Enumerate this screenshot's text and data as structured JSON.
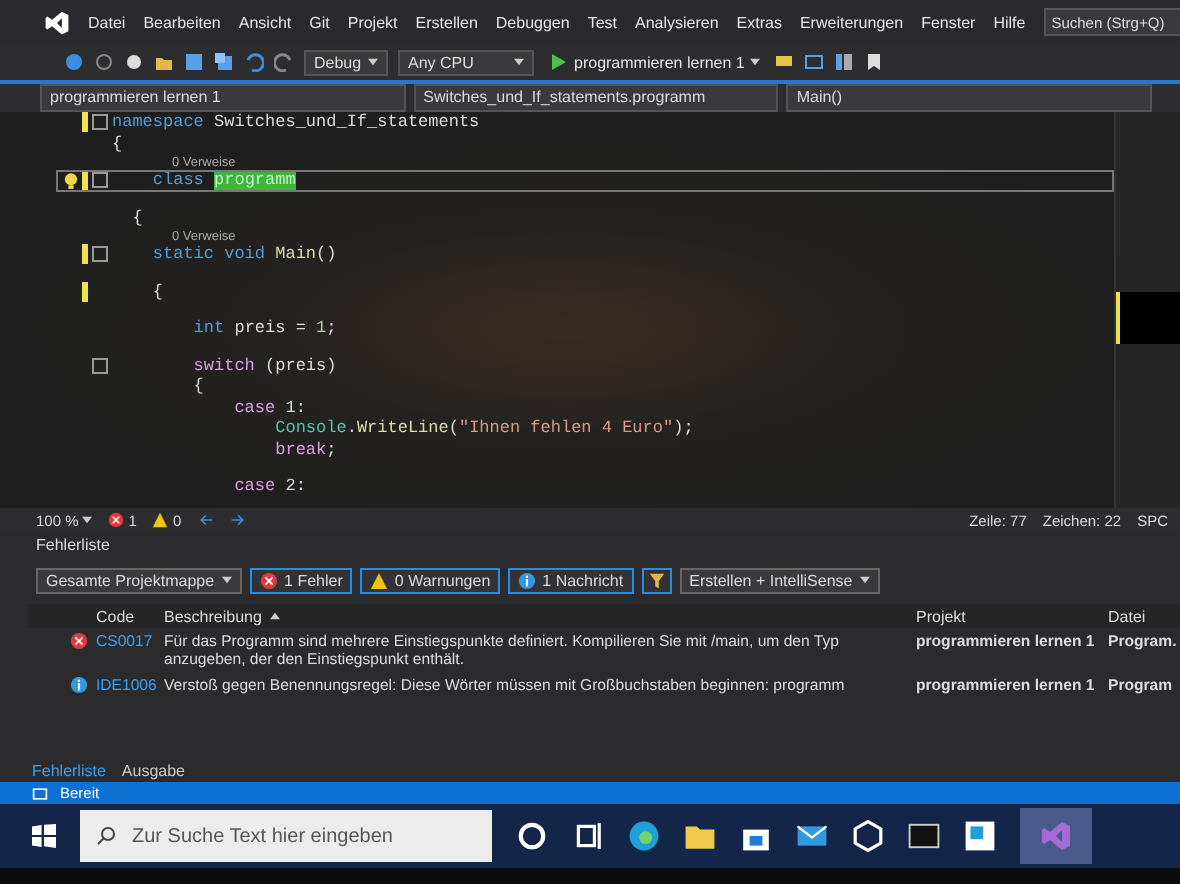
{
  "menu_bar": {
    "items": [
      "Datei",
      "Bearbeiten",
      "Ansicht",
      "Git",
      "Projekt",
      "Erstellen",
      "Debuggen",
      "Test",
      "Analysieren",
      "Extras",
      "Erweiterungen",
      "Fenster",
      "Hilfe"
    ],
    "search": {
      "placeholder": "Suchen (Strg+Q)"
    }
  },
  "toolbar": {
    "configuration": "Debug",
    "platform": "Any CPU",
    "start": "programmieren lernen 1"
  },
  "nav_bar": {
    "project": "programmieren lernen 1",
    "class": "Switches_und_If_statements.programm",
    "member": "Main()"
  },
  "editor": {
    "lines": [
      {
        "kind": "code",
        "tokens": [
          {
            "t": "namespace",
            "kind": "kw"
          },
          {
            "t": " Switches_und_If_statements",
            "kind": "plain"
          }
        ],
        "marker": true,
        "fold": true,
        "bulb": false,
        "current": false
      },
      {
        "kind": "code",
        "tokens": [
          {
            "t": "{",
            "kind": "plain"
          }
        ],
        "marker": false,
        "fold": false,
        "bulb": false,
        "current": false
      },
      {
        "kind": "code",
        "lens": "0 Verweise",
        "tokens": [
          {
            "t": "    class ",
            "kind": "kw"
          },
          {
            "t": "programm",
            "kind": "hl"
          }
        ],
        "marker": true,
        "fold": true,
        "bulb": true,
        "current": true
      },
      {
        "kind": "blank"
      },
      {
        "kind": "code",
        "tokens": [
          {
            "t": "  {",
            "kind": "plain"
          }
        ],
        "marker": false,
        "fold": false,
        "bulb": false,
        "current": false
      },
      {
        "kind": "code",
        "lens": "0 Verweise",
        "tokens": [
          {
            "t": "    static void ",
            "kind": "kw"
          },
          {
            "t": "Main",
            "kind": "method"
          },
          {
            "t": "()",
            "kind": "plain"
          }
        ],
        "marker": true,
        "fold": true,
        "bulb": false,
        "current": false
      },
      {
        "kind": "blank"
      },
      {
        "kind": "code",
        "tokens": [
          {
            "t": "    {",
            "kind": "plain"
          }
        ],
        "marker": true,
        "fold": false,
        "bulb": false,
        "current": false
      },
      {
        "kind": "blank"
      },
      {
        "kind": "code",
        "tokens": [
          {
            "t": "        int ",
            "kind": "kw"
          },
          {
            "t": "preis = ",
            "kind": "plain"
          },
          {
            "t": "1",
            "kind": "num"
          },
          {
            "t": ";",
            "kind": "plain"
          }
        ],
        "marker": false,
        "fold": false,
        "bulb": false,
        "current": false
      },
      {
        "kind": "blank"
      },
      {
        "kind": "code",
        "tokens": [
          {
            "t": "        switch ",
            "kind": "ctrl"
          },
          {
            "t": "(preis)",
            "kind": "plain"
          }
        ],
        "marker": false,
        "fold": true,
        "bulb": false,
        "current": false
      },
      {
        "kind": "code",
        "tokens": [
          {
            "t": "        {",
            "kind": "plain"
          }
        ],
        "marker": false,
        "fold": false,
        "bulb": false,
        "current": false
      },
      {
        "kind": "code",
        "tokens": [
          {
            "t": "            case ",
            "kind": "ctrl"
          },
          {
            "t": "1:",
            "kind": "plain"
          }
        ],
        "marker": false,
        "fold": false,
        "bulb": false,
        "current": false
      },
      {
        "kind": "code",
        "tokens": [
          {
            "t": "                Console",
            "kind": "type"
          },
          {
            "t": ".",
            "kind": "plain"
          },
          {
            "t": "WriteLine",
            "kind": "method"
          },
          {
            "t": "(",
            "kind": "plain"
          },
          {
            "t": "\"Ihnen fehlen 4 Euro\"",
            "kind": "str"
          },
          {
            "t": ");",
            "kind": "plain"
          }
        ],
        "marker": false,
        "fold": false,
        "bulb": false,
        "current": false
      },
      {
        "kind": "code",
        "tokens": [
          {
            "t": "                break",
            "kind": "ctrl"
          },
          {
            "t": ";",
            "kind": "plain"
          }
        ],
        "marker": false,
        "fold": false,
        "bulb": false,
        "current": false
      },
      {
        "kind": "blank"
      },
      {
        "kind": "code",
        "tokens": [
          {
            "t": "            case ",
            "kind": "ctrl"
          },
          {
            "t": "2:",
            "kind": "plain"
          }
        ],
        "marker": false,
        "fold": false,
        "bulb": false,
        "current": false
      }
    ],
    "status": {
      "zoom": "100 %",
      "errors": "1",
      "warnings": "0",
      "line": "Zeile: 77",
      "char": "Zeichen: 22",
      "mode": "SPC"
    }
  },
  "error_list": {
    "title": "Fehlerliste",
    "scope": "Gesamte Projektmappe",
    "filters": [
      {
        "kind": "error",
        "label": "1 Fehler",
        "selected": true
      },
      {
        "kind": "warning",
        "label": "0 Warnungen",
        "selected": true
      },
      {
        "kind": "info",
        "label": "1 Nachricht",
        "selected": true
      }
    ],
    "source": "Erstellen + IntelliSense",
    "columns": [
      "Code",
      "Beschreibung",
      "Projekt",
      "Datei"
    ],
    "rows": [
      {
        "kind": "error",
        "code": "CS0017",
        "description": "Für das Programm sind mehrere Einstiegspunkte definiert. Kompilieren Sie mit /main, um den Typ anzugeben, der den Einstiegspunkt enthält.",
        "project": "programmieren lernen 1",
        "file": "Program."
      },
      {
        "kind": "info",
        "code": "IDE1006",
        "description": "Verstoß gegen Benennungsregel: Diese Wörter müssen mit Großbuchstaben beginnen: programm",
        "project": "programmieren lernen 1",
        "file": "Program"
      }
    ],
    "tabs": [
      {
        "label": "Fehlerliste",
        "selected": true
      },
      {
        "label": "Ausgabe",
        "selected": false
      }
    ]
  },
  "status_bar": {
    "text": "Bereit"
  },
  "taskbar": {
    "search": {
      "placeholder": "Zur Suche Text hier eingeben"
    }
  }
}
